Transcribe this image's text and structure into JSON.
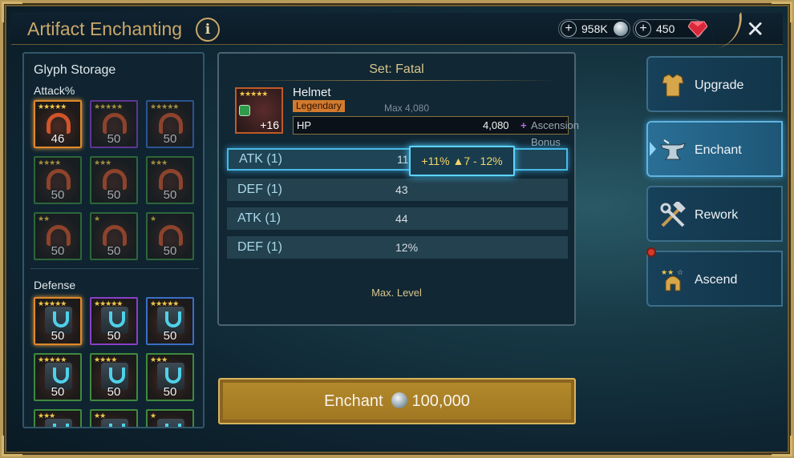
{
  "header": {
    "title": "Artifact Enchanting",
    "info": "i",
    "silver": "958K",
    "gems": "450",
    "plus": "+",
    "close": "✕"
  },
  "glyph_storage": {
    "title": "Glyph Storage",
    "attack_label": "Attack%",
    "defense_label": "Defense",
    "attack": [
      {
        "stars": "★★★★★",
        "count": "46",
        "rarity": "orange"
      },
      {
        "stars": "★★★★★",
        "count": "50",
        "rarity": "purple"
      },
      {
        "stars": "★★★★★",
        "count": "50",
        "rarity": "blue"
      },
      {
        "stars": "★★★★",
        "count": "50",
        "rarity": "green"
      },
      {
        "stars": "★★★",
        "count": "50",
        "rarity": "green"
      },
      {
        "stars": "★★★",
        "count": "50",
        "rarity": "green"
      },
      {
        "stars": "★★",
        "count": "50",
        "rarity": "green"
      },
      {
        "stars": "★",
        "count": "50",
        "rarity": "green"
      },
      {
        "stars": "★",
        "count": "50",
        "rarity": "green"
      }
    ],
    "defense": [
      {
        "stars": "★★★★★",
        "count": "50",
        "rarity": "orange"
      },
      {
        "stars": "★★★★★",
        "count": "50",
        "rarity": "purple"
      },
      {
        "stars": "★★★★★",
        "count": "50",
        "rarity": "blue"
      },
      {
        "stars": "★★★★★",
        "count": "50",
        "rarity": "green"
      },
      {
        "stars": "★★★★",
        "count": "50",
        "rarity": "green"
      },
      {
        "stars": "★★★",
        "count": "50",
        "rarity": "green"
      },
      {
        "stars": "★★★",
        "count": "",
        "rarity": "green"
      },
      {
        "stars": "★★",
        "count": "",
        "rarity": "green"
      },
      {
        "stars": "★",
        "count": "",
        "rarity": "green"
      }
    ]
  },
  "artifact": {
    "set": "Set: Fatal",
    "name": "Helmet",
    "rarity": "Legendary",
    "max": "Max 4,080",
    "stars": "★★★★★",
    "level": "+16",
    "main_stat": "HP",
    "main_value": "4,080",
    "ascension_plus": "+",
    "ascension": "Ascension Bonus"
  },
  "substats": [
    {
      "name": "ATK (1)",
      "value": "11%"
    },
    {
      "name": "DEF (1)",
      "value": "43"
    },
    {
      "name": "ATK (1)",
      "value": "44"
    },
    {
      "name": "DEF (1)",
      "value": "12%"
    }
  ],
  "boost_text": "+11% ▲7 - 12%",
  "max_level_label": "Max. Level",
  "enchant_button": {
    "label": "Enchant",
    "cost": "100,000"
  },
  "tabs": [
    {
      "label": "Upgrade",
      "icon": "armor-icon"
    },
    {
      "label": "Enchant",
      "icon": "anvil-icon"
    },
    {
      "label": "Rework",
      "icon": "hammer-wrench-icon"
    },
    {
      "label": "Ascend",
      "icon": "helmet-stars-icon"
    }
  ],
  "colors": {
    "gold": "#c9a86a",
    "accent": "#49b9e6",
    "legendary": "#d27a2e"
  }
}
